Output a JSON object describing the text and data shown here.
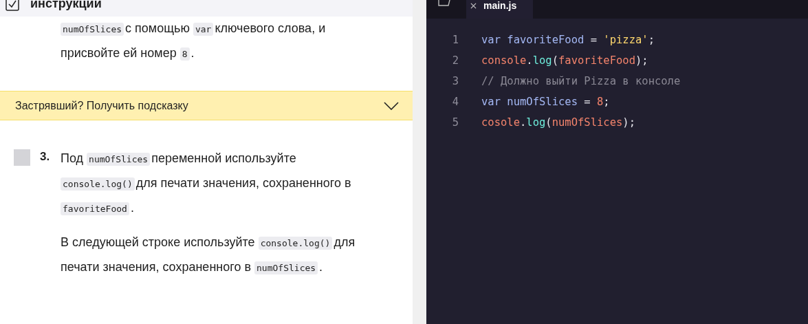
{
  "instructions": {
    "title": "инструкции",
    "checked": true,
    "top_paragraph": [
      {
        "kind": "code",
        "text": "numOfSlices"
      },
      {
        "kind": "text",
        "text": "с помощью "
      },
      {
        "kind": "code",
        "text": "var"
      },
      {
        "kind": "text",
        "text": "ключевого слова, и присвойте ей номер "
      },
      {
        "kind": "code",
        "text": "8"
      },
      {
        "kind": "text",
        "text": "."
      }
    ],
    "hint": {
      "label": "Застрявший? Получить подсказку",
      "expanded": false
    },
    "steps": [
      {
        "number": "3.",
        "checked": false,
        "paragraphs": [
          [
            {
              "kind": "text",
              "text": "Под "
            },
            {
              "kind": "code",
              "text": "numOfSlices"
            },
            {
              "kind": "text",
              "text": "переменной используйте "
            },
            {
              "kind": "code",
              "text": "console.log()"
            },
            {
              "kind": "text",
              "text": "для печати значения, сохраненного в "
            },
            {
              "kind": "code",
              "text": "favoriteFood"
            },
            {
              "kind": "text",
              "text": "."
            }
          ],
          [
            {
              "kind": "text",
              "text": "В следующей строке используйте "
            },
            {
              "kind": "code",
              "text": "console.log()"
            },
            {
              "kind": "text",
              "text": "для печати значения, сохраненного в "
            },
            {
              "kind": "code",
              "text": "numOfSlices"
            },
            {
              "kind": "text",
              "text": "."
            }
          ]
        ]
      }
    ]
  },
  "editor": {
    "tabs": [
      {
        "label": "main.js",
        "selected": true
      }
    ],
    "lines": [
      {
        "number": "1",
        "tokens": [
          {
            "kind": "keyword",
            "text": "var "
          },
          {
            "kind": "name",
            "text": "favoriteFood"
          },
          {
            "kind": "plain",
            "text": " = "
          },
          {
            "kind": "string",
            "text": "'pizza'"
          },
          {
            "kind": "plain",
            "text": ";"
          }
        ]
      },
      {
        "number": "2",
        "tokens": [
          {
            "kind": "object",
            "text": "console"
          },
          {
            "kind": "plain",
            "text": "."
          },
          {
            "kind": "method",
            "text": "log"
          },
          {
            "kind": "plain",
            "text": "("
          },
          {
            "kind": "object",
            "text": "favoriteFood"
          },
          {
            "kind": "plain",
            "text": ");"
          }
        ]
      },
      {
        "number": "3",
        "tokens": [
          {
            "kind": "comment",
            "text": "// Должно выйти Pizza в консоле"
          }
        ]
      },
      {
        "number": "4",
        "tokens": [
          {
            "kind": "keyword",
            "text": "var "
          },
          {
            "kind": "name",
            "text": "numOfSlices"
          },
          {
            "kind": "plain",
            "text": " = "
          },
          {
            "kind": "number",
            "text": "8"
          },
          {
            "kind": "plain",
            "text": ";"
          }
        ]
      },
      {
        "number": "5",
        "tokens": [
          {
            "kind": "object",
            "text": "cosole"
          },
          {
            "kind": "plain",
            "text": "."
          },
          {
            "kind": "method",
            "text": "log"
          },
          {
            "kind": "plain",
            "text": "("
          },
          {
            "kind": "object",
            "text": "numOfSlices"
          },
          {
            "kind": "plain",
            "text": ");"
          }
        ]
      }
    ]
  }
}
